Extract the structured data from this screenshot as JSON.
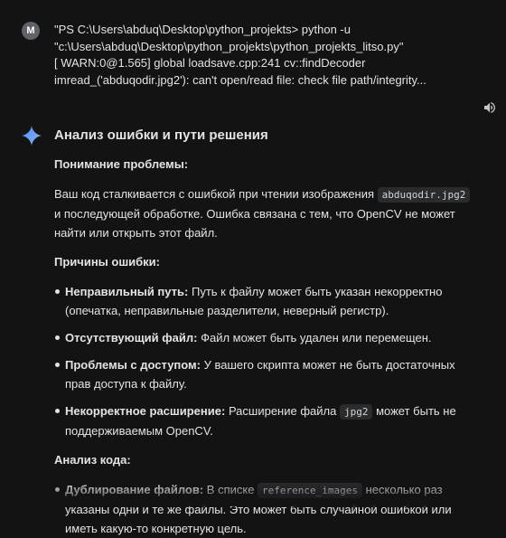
{
  "user": {
    "avatar_letter": "M",
    "message": "\"PS C:\\Users\\abduq\\Desktop\\python_projekts> python -u \"c:\\Users\\abduq\\Desktop\\python_projekts\\python_projekts_litso.py\"\n[ WARN:0@1.565] global loadsave.cpp:241 cv::findDecoder imread_('abduqodir.jpg2'): can't open/read file: check file path/integrity..."
  },
  "response": {
    "title": "Анализ ошибки и пути решения",
    "understanding_head": "Понимание проблемы:",
    "understanding_p1_a": "Ваш код сталкивается с ошибкой при чтении изображения ",
    "understanding_code": "abduqodir.jpg2",
    "understanding_p1_b": " и последующей обработке. Ошибка связана с тем, что OpenCV не может найти или открыть этот файл.",
    "causes_head": "Причины ошибки:",
    "causes": [
      {
        "bold": "Неправильный путь:",
        "text": " Путь к файлу может быть указан некорректно (опечатка, неправильные разделители, неверный регистр)."
      },
      {
        "bold": "Отсутствующий файл:",
        "text": " Файл может быть удален или перемещен."
      },
      {
        "bold": "Проблемы с доступом:",
        "text": " У вашего скрипта может не быть достаточных прав доступа к файлу."
      },
      {
        "bold": "Некорректное расширение:",
        "text_a": " Расширение файла ",
        "code": "jpg2",
        "text_b": " может быть не поддерживаемым OpenCV."
      }
    ],
    "code_head": "Анализ кода:",
    "code_items": [
      {
        "bold": "Дублирование файлов:",
        "text_a": " В списке ",
        "code": "reference_images",
        "text_b": " несколько раз указаны одни и те же файлы. Это может быть случайной ошибкой или иметь какую-то конкретную цель."
      }
    ]
  },
  "icons": {
    "speaker": "speaker-icon",
    "gemini": "gemini-sparkle-icon"
  },
  "colors": {
    "background": "#131314",
    "text": "#e3e3e3",
    "code_bg": "#2a2b2d",
    "avatar_bg": "#5f6368",
    "gemini_blue": "#4e8cf7"
  }
}
